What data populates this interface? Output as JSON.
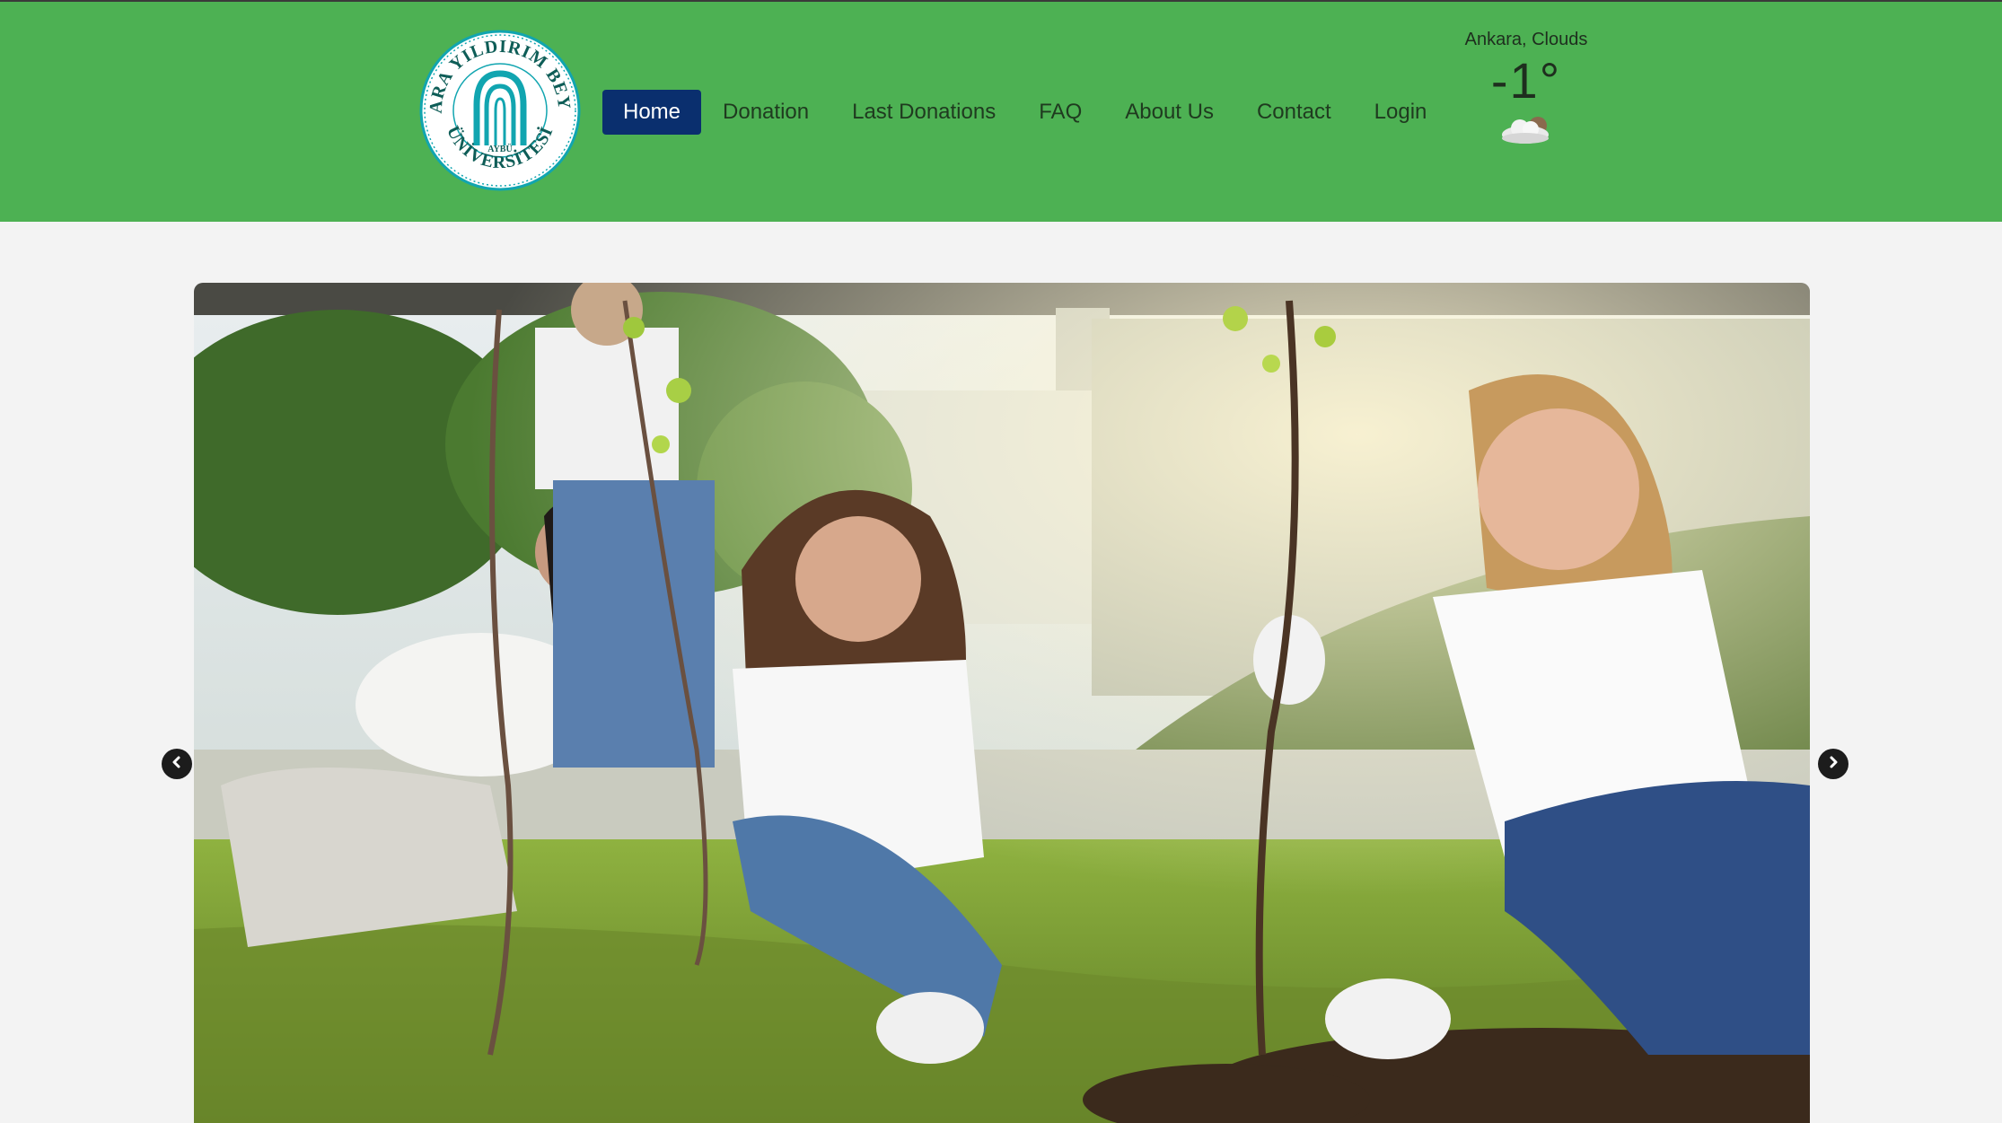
{
  "header": {
    "background": "#4db153",
    "logo": {
      "top_text": "YILDIRIM BEYAZIT",
      "left_text": "ANKARA",
      "bottom_text": "ÜNİVERSİTESİ",
      "center_text": "AYBÜ",
      "color": "#11a5b0"
    }
  },
  "nav": {
    "items": [
      {
        "label": "Home",
        "active": true
      },
      {
        "label": "Donation",
        "active": false
      },
      {
        "label": "Last Donations",
        "active": false
      },
      {
        "label": "FAQ",
        "active": false
      },
      {
        "label": "About Us",
        "active": false
      },
      {
        "label": "Contact",
        "active": false
      },
      {
        "label": "Login",
        "active": false
      }
    ],
    "active_color": "#0a2f6e"
  },
  "weather": {
    "location": "Ankara, Clouds",
    "temperature": "-1°",
    "icon": "cloudy-icon"
  },
  "carousel": {
    "image_description_icon": "tree-planting-photo",
    "prev_icon": "chevron-left-icon",
    "next_icon": "chevron-right-icon"
  }
}
